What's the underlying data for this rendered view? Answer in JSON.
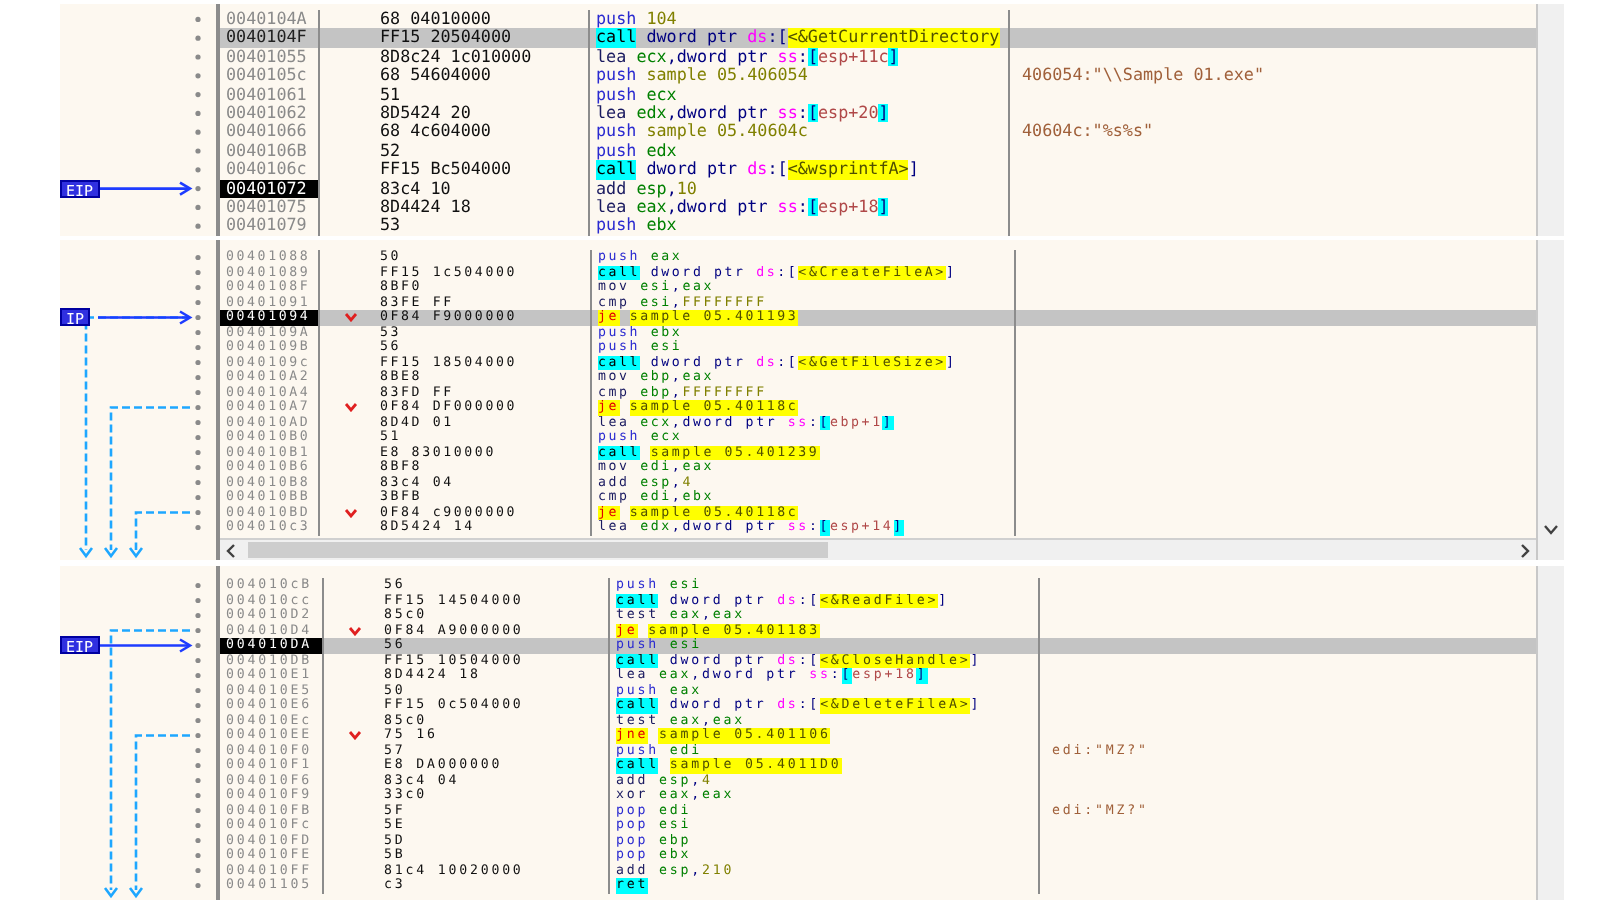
{
  "panels": [
    {
      "ip_label": "EIP",
      "rows": [
        {
          "address": "0040104A",
          "bytes": "68 04010000",
          "instruction": {
            "mnemonic": "push",
            "kind": "stack",
            "operands": [
              {
                "text": "104",
                "kind": "num"
              }
            ]
          },
          "selected": false,
          "eip": false
        },
        {
          "address": "0040104F",
          "bytes": "FF15 20504000",
          "instruction": {
            "mnemonic": "call",
            "kind": "call",
            "operands": [
              {
                "text": "dword ptr ",
                "kind": "size"
              },
              {
                "text": "ds",
                "kind": "seg"
              },
              {
                "text": ":[",
                "kind": "punct"
              },
              {
                "text": "<&GetCurrentDirectory",
                "kind": "label"
              }
            ]
          },
          "selected": true,
          "eip": false
        },
        {
          "address": "00401055",
          "bytes": "8D8c24 1c010000",
          "instruction": {
            "mnemonic": "lea",
            "kind": "other",
            "operands": [
              {
                "text": "ecx",
                "kind": "reg"
              },
              {
                "text": ",",
                "kind": "punct"
              },
              {
                "text": "dword ptr ",
                "kind": "size"
              },
              {
                "text": "ss",
                "kind": "seg"
              },
              {
                "text": ":",
                "kind": "punct"
              },
              {
                "text": "[",
                "kind": "bracket"
              },
              {
                "text": "esp+11c",
                "kind": "mem"
              },
              {
                "text": "]",
                "kind": "bracket"
              }
            ]
          },
          "selected": false,
          "eip": false
        },
        {
          "address": "0040105c",
          "bytes": "68 54604000",
          "instruction": {
            "mnemonic": "push",
            "kind": "stack",
            "operands": [
              {
                "text": "sample 05.406054",
                "kind": "addr"
              }
            ]
          },
          "comment": "406054:\"\\\\Sample 01.exe\"",
          "selected": false,
          "eip": false
        },
        {
          "address": "00401061",
          "bytes": "51",
          "instruction": {
            "mnemonic": "push",
            "kind": "stack",
            "operands": [
              {
                "text": "ecx",
                "kind": "reg"
              }
            ]
          },
          "selected": false,
          "eip": false
        },
        {
          "address": "00401062",
          "bytes": "8D5424 20",
          "instruction": {
            "mnemonic": "lea",
            "kind": "other",
            "operands": [
              {
                "text": "edx",
                "kind": "reg"
              },
              {
                "text": ",",
                "kind": "punct"
              },
              {
                "text": "dword ptr ",
                "kind": "size"
              },
              {
                "text": "ss",
                "kind": "seg"
              },
              {
                "text": ":",
                "kind": "punct"
              },
              {
                "text": "[",
                "kind": "bracket"
              },
              {
                "text": "esp+20",
                "kind": "mem"
              },
              {
                "text": "]",
                "kind": "bracket"
              }
            ]
          },
          "selected": false,
          "eip": false
        },
        {
          "address": "00401066",
          "bytes": "68 4c604000",
          "instruction": {
            "mnemonic": "push",
            "kind": "stack",
            "operands": [
              {
                "text": "sample 05.40604c",
                "kind": "addr"
              }
            ]
          },
          "comment": "40604c:\"%s%s\"",
          "selected": false,
          "eip": false
        },
        {
          "address": "0040106B",
          "bytes": "52",
          "instruction": {
            "mnemonic": "push",
            "kind": "stack",
            "operands": [
              {
                "text": "edx",
                "kind": "reg"
              }
            ]
          },
          "selected": false,
          "eip": false
        },
        {
          "address": "0040106c",
          "bytes": "FF15 Bc504000",
          "instruction": {
            "mnemonic": "call",
            "kind": "call",
            "operands": [
              {
                "text": "dword ptr ",
                "kind": "size"
              },
              {
                "text": "ds",
                "kind": "seg"
              },
              {
                "text": ":[",
                "kind": "punct"
              },
              {
                "text": "<&wsprintfA>",
                "kind": "label"
              },
              {
                "text": "]",
                "kind": "punct"
              }
            ]
          },
          "selected": false,
          "eip": false
        },
        {
          "address": "00401072",
          "bytes": "83c4 10",
          "instruction": {
            "mnemonic": "add",
            "kind": "other",
            "operands": [
              {
                "text": "esp",
                "kind": "reg"
              },
              {
                "text": ",",
                "kind": "punct"
              },
              {
                "text": "10",
                "kind": "num"
              }
            ]
          },
          "selected": false,
          "eip": true
        },
        {
          "address": "00401075",
          "bytes": "8D4424 18",
          "instruction": {
            "mnemonic": "lea",
            "kind": "other",
            "operands": [
              {
                "text": "eax",
                "kind": "reg"
              },
              {
                "text": ",",
                "kind": "punct"
              },
              {
                "text": "dword ptr ",
                "kind": "size"
              },
              {
                "text": "ss",
                "kind": "seg"
              },
              {
                "text": ":",
                "kind": "punct"
              },
              {
                "text": "[",
                "kind": "bracket"
              },
              {
                "text": "esp+18",
                "kind": "mem"
              },
              {
                "text": "]",
                "kind": "bracket"
              }
            ]
          },
          "selected": false,
          "eip": false
        },
        {
          "address": "00401079",
          "bytes": "53",
          "instruction": {
            "mnemonic": "push",
            "kind": "stack",
            "operands": [
              {
                "text": "ebx",
                "kind": "reg"
              }
            ]
          },
          "selected": false,
          "eip": false
        }
      ]
    },
    {
      "ip_label": "IP",
      "rows": [
        {
          "address": "00401088",
          "bytes": "50",
          "instruction": {
            "mnemonic": "push",
            "kind": "stack",
            "operands": [
              {
                "text": "eax",
                "kind": "reg"
              }
            ]
          },
          "selected": false,
          "eip": false
        },
        {
          "address": "00401089",
          "bytes": "FF15 1c504000",
          "instruction": {
            "mnemonic": "call",
            "kind": "call",
            "operands": [
              {
                "text": "dword ptr ",
                "kind": "size"
              },
              {
                "text": "ds",
                "kind": "seg"
              },
              {
                "text": ":[",
                "kind": "punct"
              },
              {
                "text": "<&CreateFileA>",
                "kind": "label"
              },
              {
                "text": "]",
                "kind": "punct"
              }
            ]
          },
          "selected": false,
          "eip": false
        },
        {
          "address": "0040108F",
          "bytes": "8BF0",
          "instruction": {
            "mnemonic": "mov",
            "kind": "other",
            "operands": [
              {
                "text": "esi",
                "kind": "reg"
              },
              {
                "text": ",",
                "kind": "punct"
              },
              {
                "text": "eax",
                "kind": "reg"
              }
            ]
          },
          "selected": false,
          "eip": false
        },
        {
          "address": "00401091",
          "bytes": "83FE FF",
          "instruction": {
            "mnemonic": "cmp",
            "kind": "other",
            "operands": [
              {
                "text": "esi",
                "kind": "reg"
              },
              {
                "text": ",",
                "kind": "punct"
              },
              {
                "text": "FFFFFFFF",
                "kind": "num"
              }
            ]
          },
          "selected": false,
          "eip": false
        },
        {
          "address": "00401094",
          "bytes": "0F84 F9000000",
          "instruction": {
            "mnemonic": "je",
            "kind": "jump",
            "operands": [
              {
                "text": "sample 05.401193",
                "kind": "label"
              }
            ]
          },
          "selected": true,
          "eip": true
        },
        {
          "address": "0040109A",
          "bytes": "53",
          "instruction": {
            "mnemonic": "push",
            "kind": "stack",
            "operands": [
              {
                "text": "ebx",
                "kind": "reg"
              }
            ]
          },
          "selected": false,
          "eip": false
        },
        {
          "address": "0040109B",
          "bytes": "56",
          "instruction": {
            "mnemonic": "push",
            "kind": "stack",
            "operands": [
              {
                "text": "esi",
                "kind": "reg"
              }
            ]
          },
          "selected": false,
          "eip": false
        },
        {
          "address": "0040109c",
          "bytes": "FF15 18504000",
          "instruction": {
            "mnemonic": "call",
            "kind": "call",
            "operands": [
              {
                "text": "dword ptr ",
                "kind": "size"
              },
              {
                "text": "ds",
                "kind": "seg"
              },
              {
                "text": ":[",
                "kind": "punct"
              },
              {
                "text": "<&GetFileSize>",
                "kind": "label"
              },
              {
                "text": "]",
                "kind": "punct"
              }
            ]
          },
          "selected": false,
          "eip": false
        },
        {
          "address": "004010A2",
          "bytes": "8BE8",
          "instruction": {
            "mnemonic": "mov",
            "kind": "other",
            "operands": [
              {
                "text": "ebp",
                "kind": "reg"
              },
              {
                "text": ",",
                "kind": "punct"
              },
              {
                "text": "eax",
                "kind": "reg"
              }
            ]
          },
          "selected": false,
          "eip": false
        },
        {
          "address": "004010A4",
          "bytes": "83FD FF",
          "instruction": {
            "mnemonic": "cmp",
            "kind": "other",
            "operands": [
              {
                "text": "ebp",
                "kind": "reg"
              },
              {
                "text": ",",
                "kind": "punct"
              },
              {
                "text": "FFFFFFFF",
                "kind": "num"
              }
            ]
          },
          "selected": false,
          "eip": false
        },
        {
          "address": "004010A7",
          "bytes": "0F84 DF000000",
          "instruction": {
            "mnemonic": "je",
            "kind": "jump",
            "operands": [
              {
                "text": "sample 05.40118c",
                "kind": "label"
              }
            ]
          },
          "selected": false,
          "eip": false
        },
        {
          "address": "004010AD",
          "bytes": "8D4D 01",
          "instruction": {
            "mnemonic": "lea",
            "kind": "other",
            "operands": [
              {
                "text": "ecx",
                "kind": "reg"
              },
              {
                "text": ",",
                "kind": "punct"
              },
              {
                "text": "dword ptr ",
                "kind": "size"
              },
              {
                "text": "ss",
                "kind": "seg"
              },
              {
                "text": ":",
                "kind": "punct"
              },
              {
                "text": "[",
                "kind": "bracket"
              },
              {
                "text": "ebp+1",
                "kind": "mem"
              },
              {
                "text": "]",
                "kind": "bracket"
              }
            ]
          },
          "selected": false,
          "eip": false
        },
        {
          "address": "004010B0",
          "bytes": "51",
          "instruction": {
            "mnemonic": "push",
            "kind": "stack",
            "operands": [
              {
                "text": "ecx",
                "kind": "reg"
              }
            ]
          },
          "selected": false,
          "eip": false
        },
        {
          "address": "004010B1",
          "bytes": "E8 83010000",
          "instruction": {
            "mnemonic": "call",
            "kind": "call",
            "operands": [
              {
                "text": "sample 05.401239",
                "kind": "label"
              }
            ]
          },
          "selected": false,
          "eip": false
        },
        {
          "address": "004010B6",
          "bytes": "8BF8",
          "instruction": {
            "mnemonic": "mov",
            "kind": "other",
            "operands": [
              {
                "text": "edi",
                "kind": "reg"
              },
              {
                "text": ",",
                "kind": "punct"
              },
              {
                "text": "eax",
                "kind": "reg"
              }
            ]
          },
          "selected": false,
          "eip": false
        },
        {
          "address": "004010B8",
          "bytes": "83c4 04",
          "instruction": {
            "mnemonic": "add",
            "kind": "other",
            "operands": [
              {
                "text": "esp",
                "kind": "reg"
              },
              {
                "text": ",",
                "kind": "punct"
              },
              {
                "text": "4",
                "kind": "num"
              }
            ]
          },
          "selected": false,
          "eip": false
        },
        {
          "address": "004010BB",
          "bytes": "3BFB",
          "instruction": {
            "mnemonic": "cmp",
            "kind": "other",
            "operands": [
              {
                "text": "edi",
                "kind": "reg"
              },
              {
                "text": ",",
                "kind": "punct"
              },
              {
                "text": "ebx",
                "kind": "reg"
              }
            ]
          },
          "selected": false,
          "eip": false
        },
        {
          "address": "004010BD",
          "bytes": "0F84 c9000000",
          "instruction": {
            "mnemonic": "je",
            "kind": "jump",
            "operands": [
              {
                "text": "sample 05.40118c",
                "kind": "label"
              }
            ]
          },
          "selected": false,
          "eip": false
        },
        {
          "address": "004010c3",
          "bytes": "8D5424 14",
          "instruction": {
            "mnemonic": "lea",
            "kind": "other",
            "operands": [
              {
                "text": "edx",
                "kind": "reg"
              },
              {
                "text": ",",
                "kind": "punct"
              },
              {
                "text": "dword ptr ",
                "kind": "size"
              },
              {
                "text": "ss",
                "kind": "seg"
              },
              {
                "text": ":",
                "kind": "punct"
              },
              {
                "text": "[",
                "kind": "bracket"
              },
              {
                "text": "esp+14",
                "kind": "mem"
              },
              {
                "text": "]",
                "kind": "bracket"
              }
            ]
          },
          "selected": false,
          "eip": false
        }
      ]
    },
    {
      "ip_label": "EIP",
      "rows": [
        {
          "address": "004010cB",
          "bytes": "56",
          "instruction": {
            "mnemonic": "push",
            "kind": "stack",
            "operands": [
              {
                "text": "esi",
                "kind": "reg"
              }
            ]
          },
          "selected": false,
          "eip": false
        },
        {
          "address": "004010cc",
          "bytes": "FF15 14504000",
          "instruction": {
            "mnemonic": "call",
            "kind": "call",
            "operands": [
              {
                "text": "dword ptr ",
                "kind": "size"
              },
              {
                "text": "ds",
                "kind": "seg"
              },
              {
                "text": ":[",
                "kind": "punct"
              },
              {
                "text": "<&ReadFile>",
                "kind": "label"
              },
              {
                "text": "]",
                "kind": "punct"
              }
            ]
          },
          "selected": false,
          "eip": false
        },
        {
          "address": "004010D2",
          "bytes": "85c0",
          "instruction": {
            "mnemonic": "test",
            "kind": "other",
            "operands": [
              {
                "text": "eax",
                "kind": "reg"
              },
              {
                "text": ",",
                "kind": "punct"
              },
              {
                "text": "eax",
                "kind": "reg"
              }
            ]
          },
          "selected": false,
          "eip": false
        },
        {
          "address": "004010D4",
          "bytes": "0F84 A9000000",
          "instruction": {
            "mnemonic": "je",
            "kind": "jump",
            "operands": [
              {
                "text": "sample 05.401183",
                "kind": "label"
              }
            ]
          },
          "selected": false,
          "eip": false
        },
        {
          "address": "004010DA",
          "bytes": "56",
          "instruction": {
            "mnemonic": "push",
            "kind": "stack",
            "operands": [
              {
                "text": "esi",
                "kind": "reg"
              }
            ]
          },
          "selected": true,
          "eip": true
        },
        {
          "address": "004010DB",
          "bytes": "FF15 10504000",
          "instruction": {
            "mnemonic": "call",
            "kind": "call",
            "operands": [
              {
                "text": "dword ptr ",
                "kind": "size"
              },
              {
                "text": "ds",
                "kind": "seg"
              },
              {
                "text": ":[",
                "kind": "punct"
              },
              {
                "text": "<&CloseHandle>",
                "kind": "label"
              },
              {
                "text": "]",
                "kind": "punct"
              }
            ]
          },
          "selected": false,
          "eip": false
        },
        {
          "address": "004010E1",
          "bytes": "8D4424 18",
          "instruction": {
            "mnemonic": "lea",
            "kind": "other",
            "operands": [
              {
                "text": "eax",
                "kind": "reg"
              },
              {
                "text": ",",
                "kind": "punct"
              },
              {
                "text": "dword ptr ",
                "kind": "size"
              },
              {
                "text": "ss",
                "kind": "seg"
              },
              {
                "text": ":",
                "kind": "punct"
              },
              {
                "text": "[",
                "kind": "bracket"
              },
              {
                "text": "esp+18",
                "kind": "mem"
              },
              {
                "text": "]",
                "kind": "bracket"
              }
            ]
          },
          "selected": false,
          "eip": false
        },
        {
          "address": "004010E5",
          "bytes": "50",
          "instruction": {
            "mnemonic": "push",
            "kind": "stack",
            "operands": [
              {
                "text": "eax",
                "kind": "reg"
              }
            ]
          },
          "selected": false,
          "eip": false
        },
        {
          "address": "004010E6",
          "bytes": "FF15 0c504000",
          "instruction": {
            "mnemonic": "call",
            "kind": "call",
            "operands": [
              {
                "text": "dword ptr ",
                "kind": "size"
              },
              {
                "text": "ds",
                "kind": "seg"
              },
              {
                "text": ":[",
                "kind": "punct"
              },
              {
                "text": "<&DeleteFileA>",
                "kind": "label"
              },
              {
                "text": "]",
                "kind": "punct"
              }
            ]
          },
          "selected": false,
          "eip": false
        },
        {
          "address": "004010Ec",
          "bytes": "85c0",
          "instruction": {
            "mnemonic": "test",
            "kind": "other",
            "operands": [
              {
                "text": "eax",
                "kind": "reg"
              },
              {
                "text": ",",
                "kind": "punct"
              },
              {
                "text": "eax",
                "kind": "reg"
              }
            ]
          },
          "selected": false,
          "eip": false
        },
        {
          "address": "004010EE",
          "bytes": "75 16",
          "instruction": {
            "mnemonic": "jne",
            "kind": "jump",
            "operands": [
              {
                "text": "sample 05.401106",
                "kind": "label"
              }
            ]
          },
          "selected": false,
          "eip": false
        },
        {
          "address": "004010F0",
          "bytes": "57",
          "instruction": {
            "mnemonic": "push",
            "kind": "stack",
            "operands": [
              {
                "text": "edi",
                "kind": "reg"
              }
            ]
          },
          "comment": "edi:\"MZ?\"",
          "selected": false,
          "eip": false
        },
        {
          "address": "004010F1",
          "bytes": "E8 DA000000",
          "instruction": {
            "mnemonic": "call",
            "kind": "call",
            "operands": [
              {
                "text": "sample 05.4011D0",
                "kind": "label"
              }
            ]
          },
          "selected": false,
          "eip": false
        },
        {
          "address": "004010F6",
          "bytes": "83c4 04",
          "instruction": {
            "mnemonic": "add",
            "kind": "other",
            "operands": [
              {
                "text": "esp",
                "kind": "reg"
              },
              {
                "text": ",",
                "kind": "punct"
              },
              {
                "text": "4",
                "kind": "num"
              }
            ]
          },
          "selected": false,
          "eip": false
        },
        {
          "address": "004010F9",
          "bytes": "33c0",
          "instruction": {
            "mnemonic": "xor",
            "kind": "other",
            "operands": [
              {
                "text": "eax",
                "kind": "reg"
              },
              {
                "text": ",",
                "kind": "punct"
              },
              {
                "text": "eax",
                "kind": "reg"
              }
            ]
          },
          "selected": false,
          "eip": false
        },
        {
          "address": "004010FB",
          "bytes": "5F",
          "instruction": {
            "mnemonic": "pop",
            "kind": "stack",
            "operands": [
              {
                "text": "edi",
                "kind": "reg"
              }
            ]
          },
          "comment": "edi:\"MZ?\"",
          "selected": false,
          "eip": false
        },
        {
          "address": "004010Fc",
          "bytes": "5E",
          "instruction": {
            "mnemonic": "pop",
            "kind": "stack",
            "operands": [
              {
                "text": "esi",
                "kind": "reg"
              }
            ]
          },
          "selected": false,
          "eip": false
        },
        {
          "address": "004010FD",
          "bytes": "5D",
          "instruction": {
            "mnemonic": "pop",
            "kind": "stack",
            "operands": [
              {
                "text": "ebp",
                "kind": "reg"
              }
            ]
          },
          "selected": false,
          "eip": false
        },
        {
          "address": "004010FE",
          "bytes": "5B",
          "instruction": {
            "mnemonic": "pop",
            "kind": "stack",
            "operands": [
              {
                "text": "ebx",
                "kind": "reg"
              }
            ]
          },
          "selected": false,
          "eip": false
        },
        {
          "address": "004010FF",
          "bytes": "81c4 10020000",
          "instruction": {
            "mnemonic": "add",
            "kind": "other",
            "operands": [
              {
                "text": "esp",
                "kind": "reg"
              },
              {
                "text": ",",
                "kind": "punct"
              },
              {
                "text": "210",
                "kind": "num"
              }
            ]
          },
          "selected": false,
          "eip": false
        },
        {
          "address": "00401105",
          "bytes": "c3",
          "instruction": {
            "mnemonic": "ret",
            "kind": "ret"
          },
          "selected": false,
          "eip": false
        }
      ]
    }
  ]
}
